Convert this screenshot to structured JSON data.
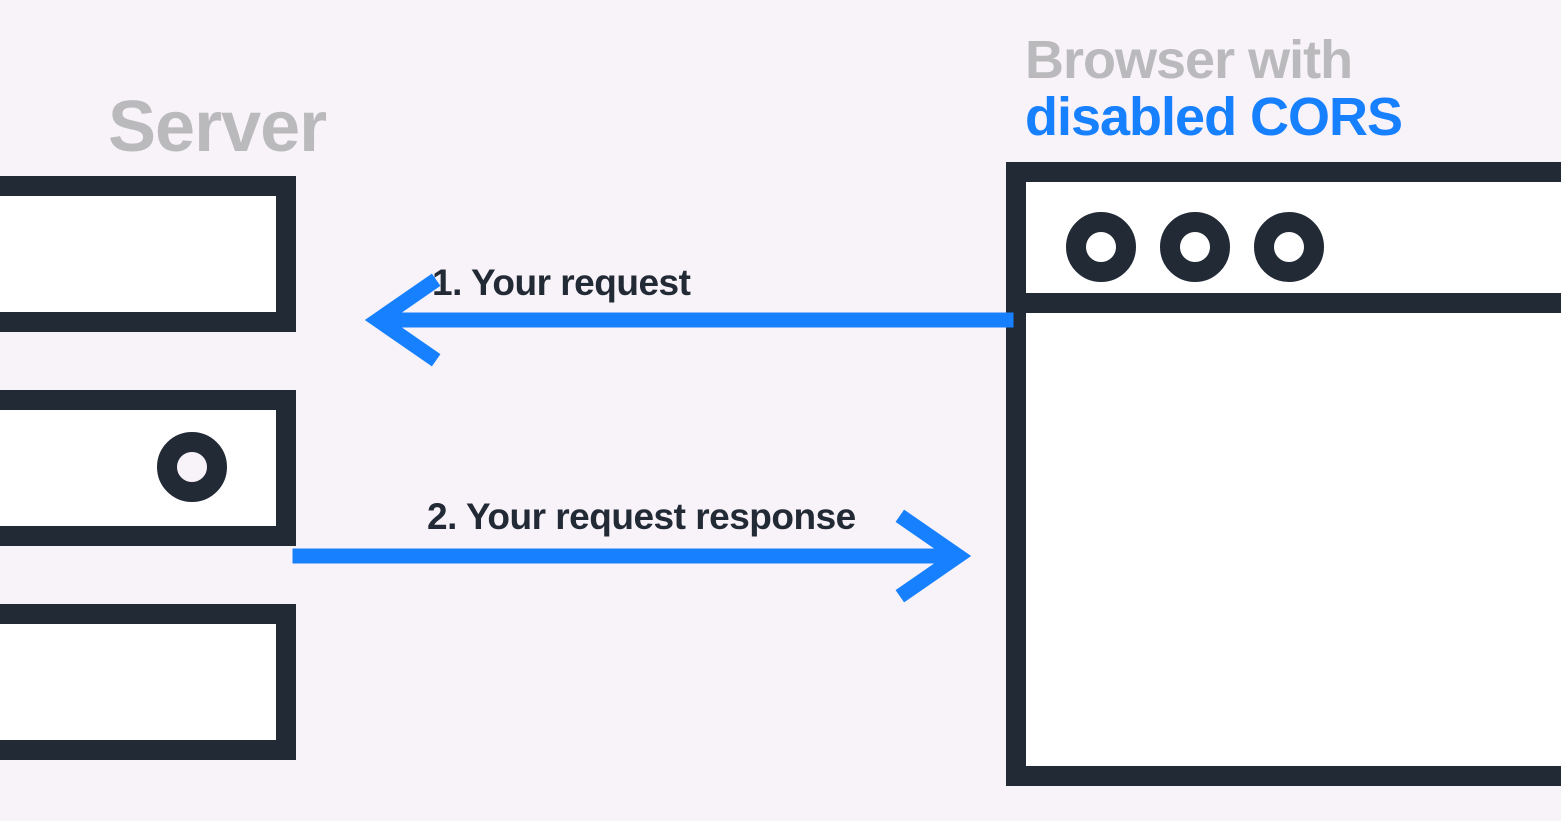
{
  "labels": {
    "server_title": "Server",
    "browser_title_line1": "Browser with",
    "browser_title_line2": "disabled CORS",
    "arrow1": "1. Your request",
    "arrow2": "2. Your request response"
  },
  "colors": {
    "bg": "#f8f2f9",
    "stroke": "#222a36",
    "muted": "#bababc",
    "accent": "#1680ff"
  },
  "arrows": [
    {
      "from": "browser",
      "to": "server",
      "label_key": "arrow1"
    },
    {
      "from": "server",
      "to": "browser",
      "label_key": "arrow2"
    }
  ]
}
